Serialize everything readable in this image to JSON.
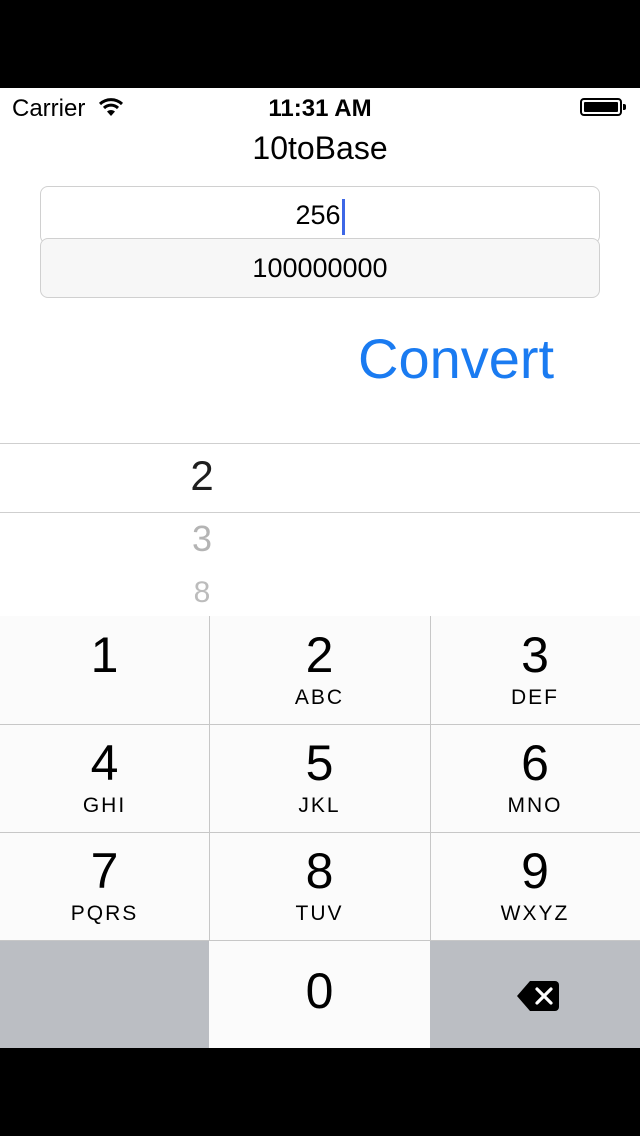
{
  "status_bar": {
    "carrier": "Carrier",
    "time": "11:31 AM"
  },
  "nav": {
    "title": "10toBase"
  },
  "input": {
    "value": "256"
  },
  "output": {
    "value": "100000000"
  },
  "convert_button": {
    "label": "Convert"
  },
  "picker": {
    "items": [
      "2",
      "3",
      "8"
    ],
    "selected": "2"
  },
  "keypad": {
    "keys": [
      {
        "num": "1",
        "letters": ""
      },
      {
        "num": "2",
        "letters": "ABC"
      },
      {
        "num": "3",
        "letters": "DEF"
      },
      {
        "num": "4",
        "letters": "GHI"
      },
      {
        "num": "5",
        "letters": "JKL"
      },
      {
        "num": "6",
        "letters": "MNO"
      },
      {
        "num": "7",
        "letters": "PQRS"
      },
      {
        "num": "8",
        "letters": "TUV"
      },
      {
        "num": "9",
        "letters": "WXYZ"
      },
      {
        "num": "0",
        "letters": ""
      }
    ]
  },
  "colors": {
    "accent": "#1a7bf1",
    "caret": "#3d67e6",
    "key_dark": "#bbbec3"
  }
}
